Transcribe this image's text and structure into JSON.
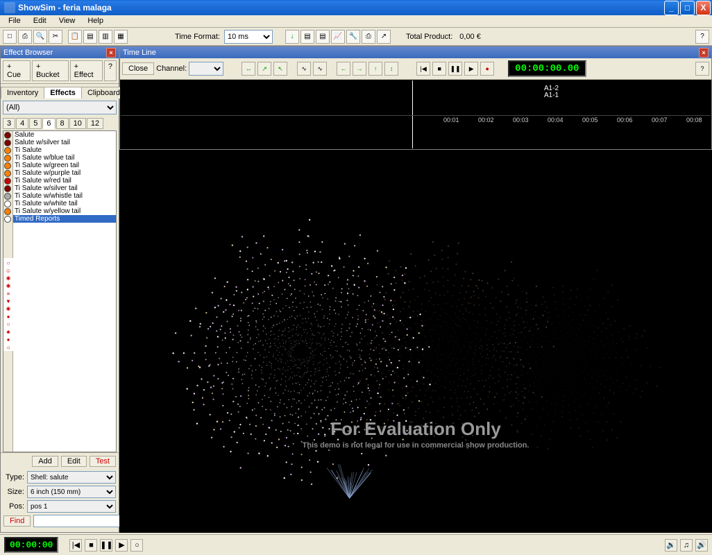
{
  "window": {
    "title": "ShowSim - feria malaga"
  },
  "menu": {
    "file": "File",
    "edit": "Edit",
    "view": "View",
    "help": "Help"
  },
  "toolbar": {
    "time_format_label": "Time Format:",
    "time_format_value": "10 ms",
    "total_product_label": "Total Product:",
    "total_product_value": "0,00 €"
  },
  "effect_browser": {
    "title": "Effect Browser",
    "btn_cue": "+ Cue",
    "btn_bucket": "+ Bucket",
    "btn_effect": "+ Effect",
    "btn_help": "?",
    "tabs": {
      "inventory": "Inventory",
      "effects": "Effects",
      "clipboard": "Clipboard"
    },
    "filter_value": "(All)",
    "sizes": [
      "3",
      "4",
      "5",
      "6",
      "8",
      "10",
      "12"
    ],
    "active_size": "6",
    "items": [
      {
        "label": "Salute",
        "color": "#800000"
      },
      {
        "label": "Salute w/silver tail",
        "color": "#800000"
      },
      {
        "label": "Ti Salute",
        "color": "#ff7f00"
      },
      {
        "label": "Ti Salute w/blue tail",
        "color": "#ff7f00"
      },
      {
        "label": "Ti Salute w/green tail",
        "color": "#ff7f00"
      },
      {
        "label": "Ti Salute w/purple tail",
        "color": "#ff7f00"
      },
      {
        "label": "Ti Salute w/red tail",
        "color": "#cc0000"
      },
      {
        "label": "Ti Salute w/silver tail",
        "color": "#800000"
      },
      {
        "label": "Ti Salute w/whistle tail",
        "color": "#aaaaaa"
      },
      {
        "label": "Ti Salute w/white tail",
        "color": "#ffffff"
      },
      {
        "label": "Ti Salute w/yellow tail",
        "color": "#ff7f00"
      },
      {
        "label": "Timed Reports",
        "color": "#ffffff",
        "selected": true
      }
    ],
    "shape_icons": [
      "○",
      "☺",
      "✱",
      "✱",
      "≡",
      "▼",
      "✱",
      "●",
      "○",
      "♣",
      "●",
      "☼"
    ],
    "actions": {
      "add": "Add",
      "edit": "Edit",
      "test": "Test"
    },
    "type_label": "Type:",
    "type_value": "Shell: salute",
    "size_label": "Size:",
    "size_value": "6 inch (150 mm)",
    "pos_label": "Pos:",
    "pos_value": "pos 1",
    "find": "Find"
  },
  "timeline": {
    "title": "Time Line",
    "close": "Close",
    "channel_label": "Channel:",
    "time_display": "00:00:00.00",
    "help": "?",
    "labels": [
      "A1-2",
      "A1-1"
    ],
    "ticks": [
      "00:01",
      "00:02",
      "00:03",
      "00:04",
      "00:05",
      "00:06",
      "00:07",
      "00:08"
    ]
  },
  "sim": {
    "eval_title": "For Evaluation Only",
    "eval_sub": "This demo is not legal for use in commercial show production."
  },
  "status": {
    "time": "00:00:00"
  }
}
